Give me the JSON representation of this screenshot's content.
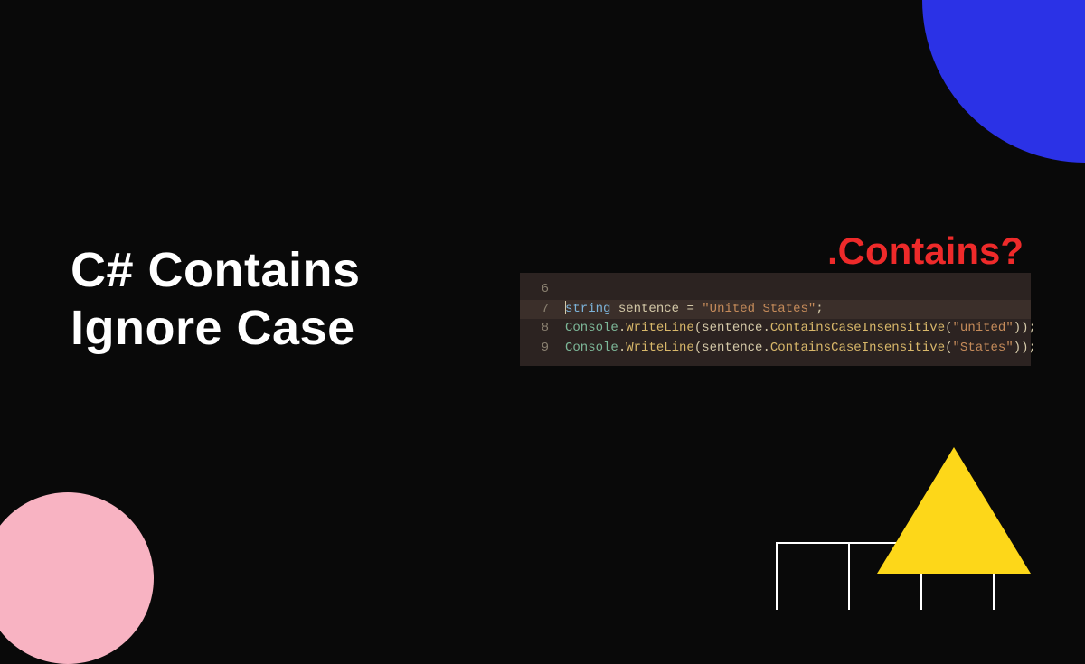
{
  "title": {
    "line1": "C# Contains",
    "line2": "Ignore Case"
  },
  "contains_label": ".Contains?",
  "code": {
    "lines": [
      {
        "num": "6",
        "highlighted": false,
        "tokens": []
      },
      {
        "num": "7",
        "highlighted": true,
        "tokens": [
          {
            "t": "cursor"
          },
          {
            "t": "kw",
            "v": "string"
          },
          {
            "t": "sp"
          },
          {
            "t": "ident",
            "v": "sentence"
          },
          {
            "t": "sp"
          },
          {
            "t": "op",
            "v": "="
          },
          {
            "t": "sp"
          },
          {
            "t": "str",
            "v": "\"United States\""
          },
          {
            "t": "op",
            "v": ";"
          }
        ]
      },
      {
        "num": "8",
        "highlighted": false,
        "tokens": [
          {
            "t": "cls",
            "v": "Console"
          },
          {
            "t": "op",
            "v": "."
          },
          {
            "t": "method",
            "v": "WriteLine"
          },
          {
            "t": "paren",
            "v": "("
          },
          {
            "t": "ident",
            "v": "sentence"
          },
          {
            "t": "op",
            "v": "."
          },
          {
            "t": "method",
            "v": "ContainsCaseInsensitive"
          },
          {
            "t": "paren",
            "v": "("
          },
          {
            "t": "str",
            "v": "\"united\""
          },
          {
            "t": "paren",
            "v": "))"
          },
          {
            "t": "op",
            "v": ";"
          }
        ]
      },
      {
        "num": "9",
        "highlighted": false,
        "tokens": [
          {
            "t": "cls",
            "v": "Console"
          },
          {
            "t": "op",
            "v": "."
          },
          {
            "t": "method",
            "v": "WriteLine"
          },
          {
            "t": "paren",
            "v": "("
          },
          {
            "t": "ident",
            "v": "sentence"
          },
          {
            "t": "op",
            "v": "."
          },
          {
            "t": "method",
            "v": "ContainsCaseInsensitive"
          },
          {
            "t": "paren",
            "v": "("
          },
          {
            "t": "str",
            "v": "\"States\""
          },
          {
            "t": "paren",
            "v": "))"
          },
          {
            "t": "op",
            "v": ";"
          }
        ]
      }
    ]
  }
}
